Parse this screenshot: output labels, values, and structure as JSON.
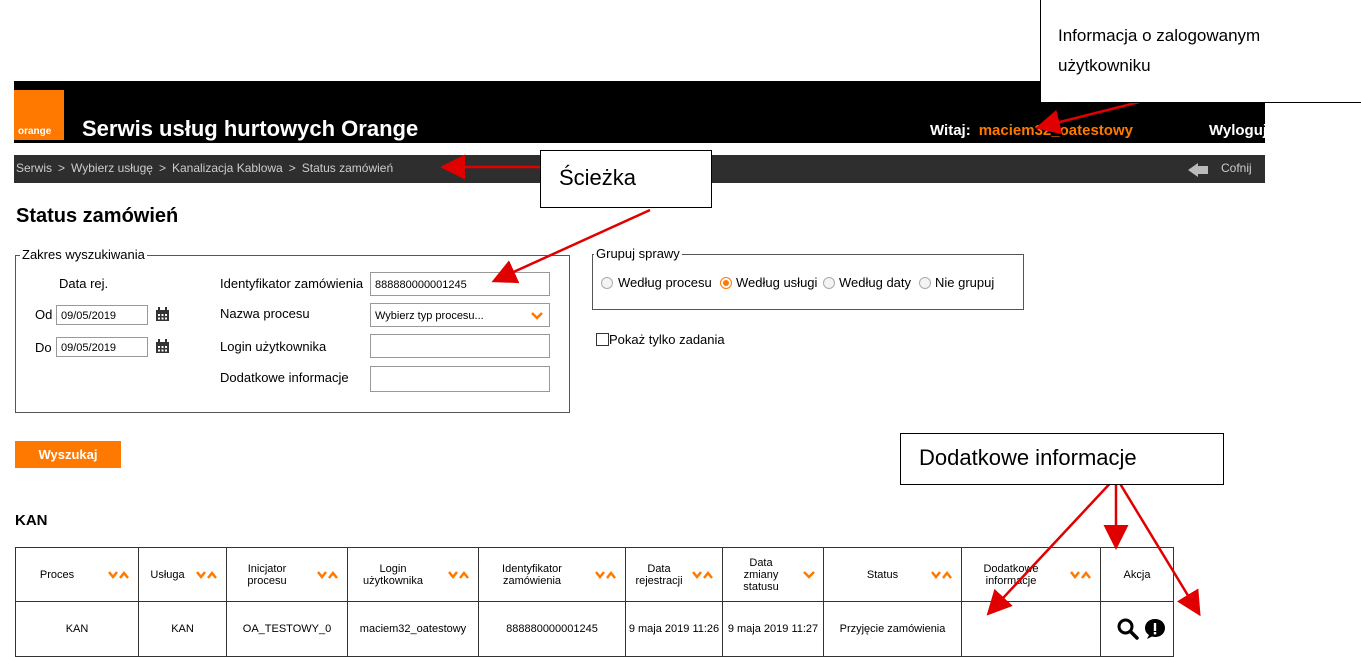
{
  "header": {
    "logo_text": "orange",
    "site_title": "Serwis usług hurtowych Orange",
    "greeting_label": "Witaj:",
    "username": "maciem32_oatestowy",
    "logout_label": "Wyloguj"
  },
  "breadcrumb": {
    "items": [
      "Serwis",
      "Wybierz usługę",
      "Kanalizacja Kablowa",
      "Status zamówień"
    ],
    "separator": ">",
    "back_label": "Cofnij"
  },
  "page_title": "Status zamówień",
  "search_range": {
    "legend": "Zakres wyszukiwania",
    "date_reg_label": "Data rej.",
    "from_label": "Od",
    "from_value": "09/05/2019",
    "to_label": "Do",
    "to_value": "09/05/2019",
    "order_id_label": "Identyfikator zamówienia",
    "order_id_value": "888880000001245",
    "process_name_label": "Nazwa procesu",
    "process_select_value": "Wybierz typ procesu...",
    "user_login_label": "Login użytkownika",
    "user_login_value": "",
    "extra_info_label": "Dodatkowe informacje",
    "extra_info_value": ""
  },
  "group_by": {
    "legend": "Grupuj sprawy",
    "options": [
      "Według procesu",
      "Według usługi",
      "Według daty",
      "Nie grupuj"
    ],
    "selected": "Według usługi"
  },
  "show_tasks_label": "Pokaż tylko zadania",
  "search_button": "Wyszukaj",
  "section_title": "KAN",
  "table": {
    "headers": [
      "Proces",
      "Usługa",
      "Inicjator procesu",
      "Login użytkownika",
      "Identyfikator zamówienia",
      "Data rejestracji",
      "Data zmiany statusu",
      "Status",
      "Dodatkowe informacje",
      "Akcja"
    ],
    "rows": [
      [
        "KAN",
        "KAN",
        "OA_TESTOWY_0",
        "maciem32_oatestowy",
        "888880000001245",
        "9 maja 2019 11:26",
        "9 maja 2019 11:27",
        "Przyjęcie zamówienia",
        ""
      ]
    ]
  },
  "annotations": {
    "user_info": "Informacja o zalogowanym użytkowniku",
    "path": "Ścieżka",
    "extra_info": "Dodatkowe informacje"
  },
  "colors": {
    "accent": "#ff7900",
    "header_bg": "#000000",
    "breadcrumb_bg": "#2e2e2e",
    "annotation_arrow": "#e00000"
  }
}
